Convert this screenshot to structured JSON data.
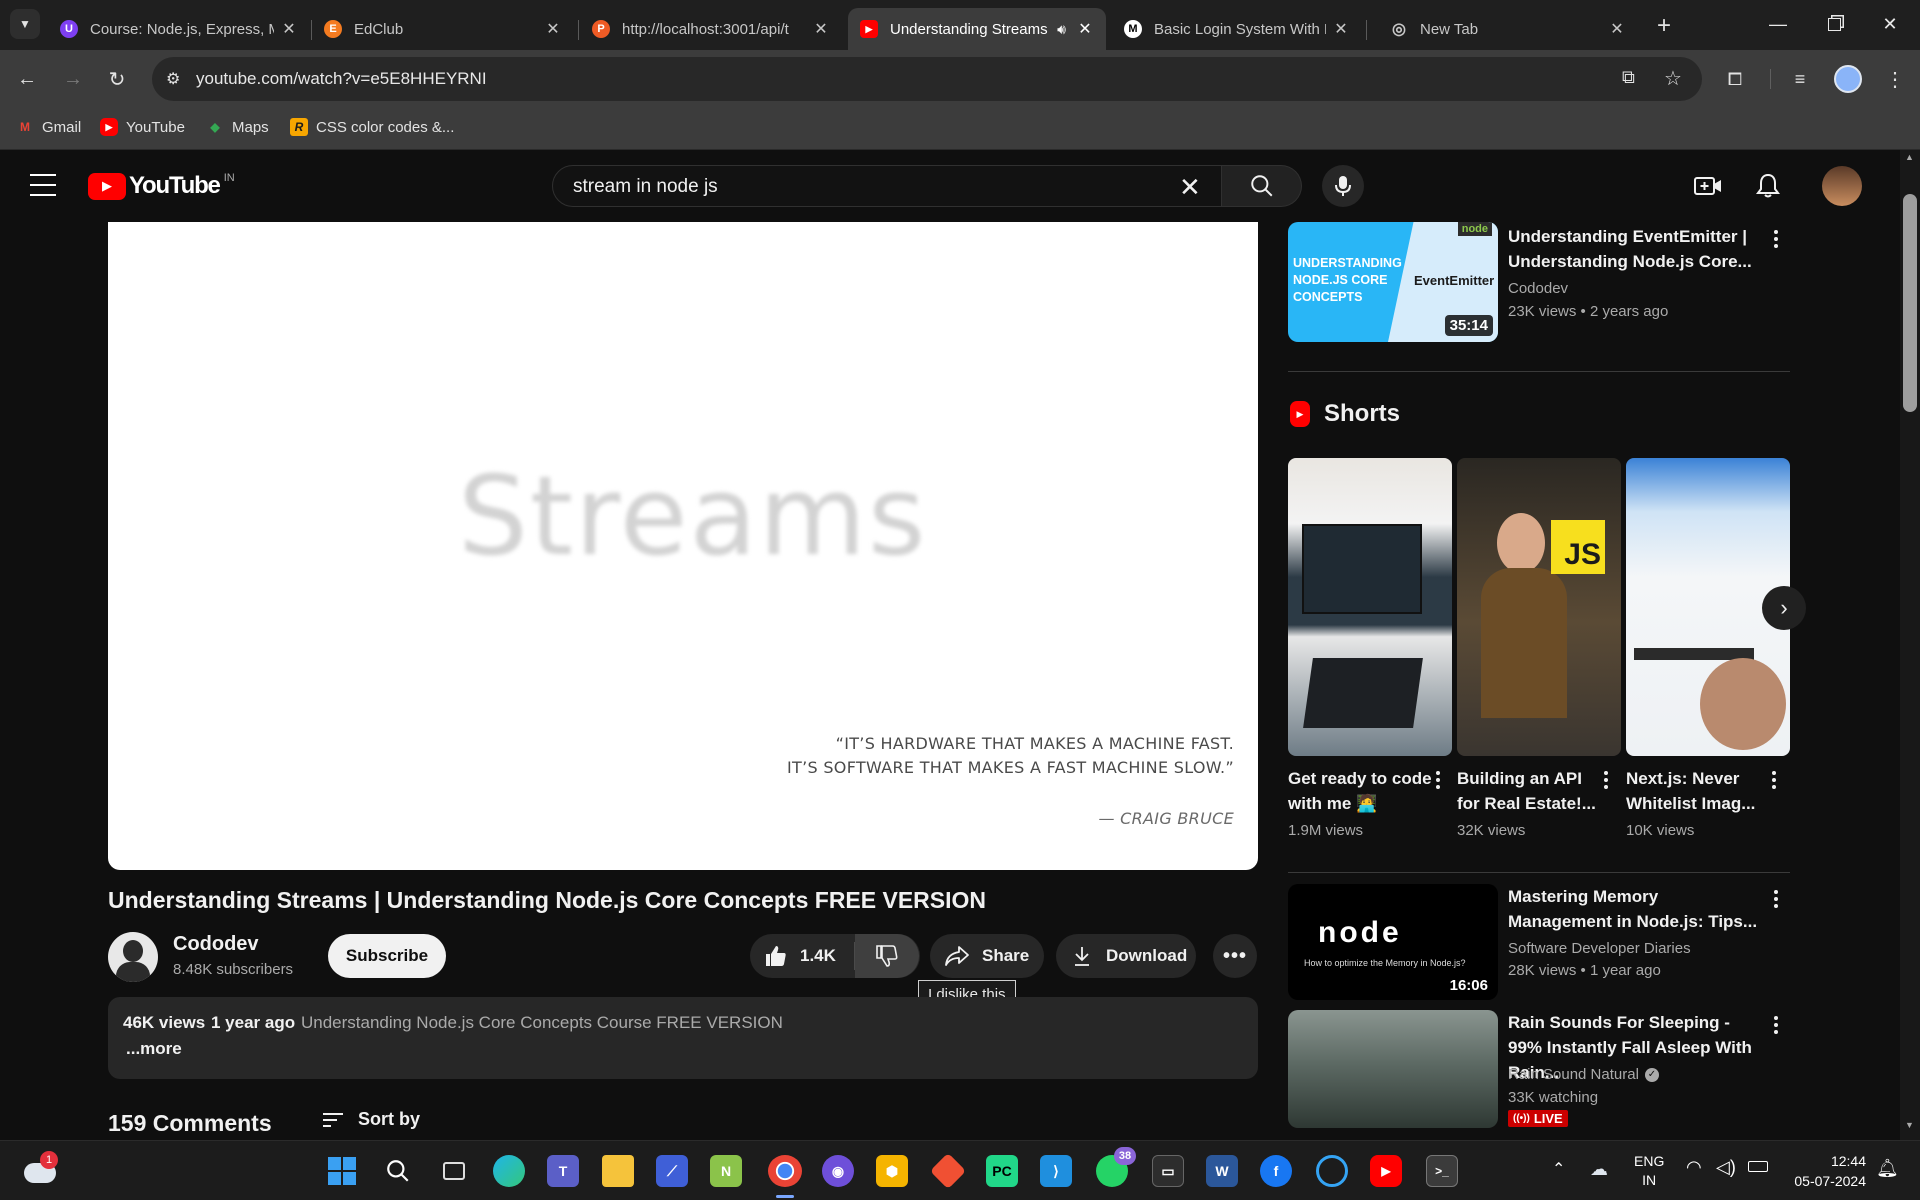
{
  "browser": {
    "tabs": [
      {
        "title": "Course: Node.js, Express, M",
        "color": "#7e3ff2",
        "glyph": "U"
      },
      {
        "title": "EdClub",
        "color": "#f47b20",
        "glyph": "E"
      },
      {
        "title": "http://localhost:3001/api/t",
        "color": "#ef5b25",
        "glyph": "P"
      },
      {
        "title": "Understanding Streams",
        "color": "#ff0000",
        "glyph": "▶"
      },
      {
        "title": "Basic Login System With N",
        "color": "#ffffff",
        "glyph": "M"
      },
      {
        "title": "New Tab",
        "color": "#9aa0a6",
        "glyph": "◎"
      }
    ],
    "url": "youtube.com/watch?v=e5E8HHEYRNI",
    "bookmarks": [
      {
        "label": "Gmail",
        "color": "#ea4335",
        "glyph": "M"
      },
      {
        "label": "YouTube",
        "color": "#ff0000",
        "glyph": "▶"
      },
      {
        "label": "Maps",
        "color": "#34a853",
        "glyph": "◆"
      },
      {
        "label": "CSS color codes &...",
        "color": "#f7a600",
        "glyph": "R"
      }
    ]
  },
  "youtube": {
    "logo_text": "YouTube",
    "region": "IN",
    "search_query": "stream in node js",
    "player": {
      "slide_word": "Streams",
      "quote_line1": "“IT’S HARDWARE THAT MAKES A MACHINE FAST.",
      "quote_line2": "IT’S SOFTWARE THAT MAKES A FAST MACHINE SLOW.”",
      "quote_author": "— CRAIG BRUCE"
    },
    "video": {
      "title": "Understanding Streams | Understanding Node.js Core Concepts FREE VERSION",
      "channel": "Cododev",
      "subscribers": "8.48K subscribers",
      "subscribe_label": "Subscribe",
      "likes": "1.4K",
      "share_label": "Share",
      "download_label": "Download",
      "dislike_tooltip": "I dislike this",
      "views": "46K views",
      "age": "1 year ago",
      "desc_line": "Understanding Node.js Core Concepts Course FREE VERSION",
      "more_label": "...more",
      "comments_count": "159 Comments",
      "sort_label": "Sort by"
    },
    "sidebar": {
      "top_rec": {
        "title": "Understanding EventEmitter | Understanding Node.js Core...",
        "channel": "Cododev",
        "meta": "23K views  • 2 years ago",
        "duration": "35:14",
        "thumb_text": "UNDERSTANDING NODE.JS CORE CONCEPTS",
        "thumb_label": "EventEmitter",
        "thumb_badge": "node"
      },
      "shorts_heading": "Shorts",
      "shorts": [
        {
          "title": "Get ready to code with me 🧑‍💻",
          "views": "1.9M views"
        },
        {
          "title": "Building an API for Real Estate!...",
          "views": "32K views",
          "badge": "JS"
        },
        {
          "title": "Next.js: Never Whitelist Imag...",
          "views": "10K views"
        }
      ],
      "recs": [
        {
          "title": "Mastering Memory Management in Node.js: Tips...",
          "channel": "Software Developer Diaries",
          "meta": "28K views  • 1 year ago",
          "duration": "16:06",
          "thumb_text": "node",
          "thumb_sub": "How to optimize the Memory in Node.js?"
        },
        {
          "title": "Rain Sounds For Sleeping - 99% Instantly Fall Asleep With Rain...",
          "channel": "Rain Sound Natural",
          "meta": "33K watching",
          "live_label": "LIVE"
        }
      ]
    }
  },
  "taskbar": {
    "weather_badge": "1",
    "whatsapp_badge": "38",
    "lang_line1": "ENG",
    "lang_line2": "IN",
    "time": "12:44",
    "date": "05-07-2024"
  }
}
